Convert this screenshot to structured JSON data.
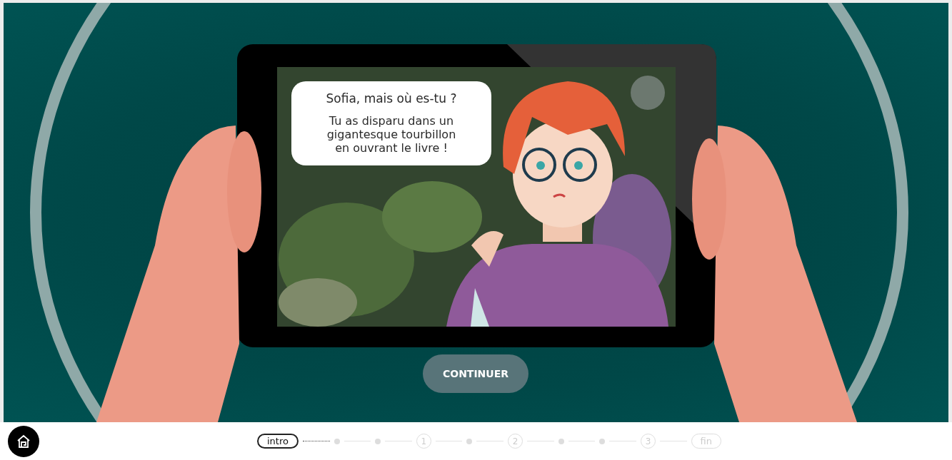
{
  "speech_bubble": {
    "question": "Sofia, mais où es-tu ?",
    "lines": [
      "Tu as disparu dans un",
      "gigantesque tourbillon",
      "en ouvrant le livre !"
    ]
  },
  "continue_button": {
    "label": "CONTINUER"
  },
  "progress": {
    "steps": [
      {
        "kind": "pill",
        "text": "intro",
        "selected": true
      },
      {
        "kind": "dot",
        "selected": false
      },
      {
        "kind": "dot",
        "selected": false
      },
      {
        "kind": "number",
        "text": "1",
        "selected": false
      },
      {
        "kind": "dot",
        "selected": false
      },
      {
        "kind": "number",
        "text": "2",
        "selected": false
      },
      {
        "kind": "dot",
        "selected": false
      },
      {
        "kind": "dot",
        "selected": false
      },
      {
        "kind": "number",
        "text": "3",
        "selected": false
      },
      {
        "kind": "pill",
        "text": "fin",
        "selected": false
      }
    ]
  }
}
